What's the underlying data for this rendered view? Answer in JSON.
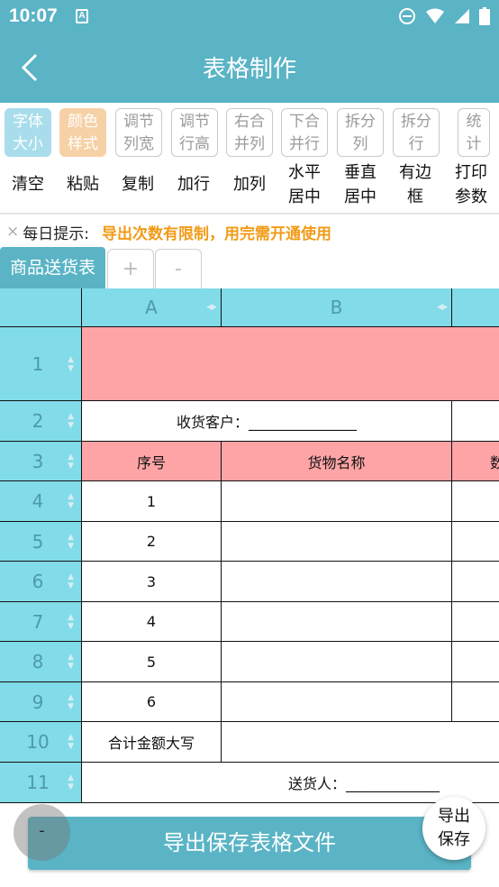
{
  "status": {
    "time": "10:07",
    "app_badge": "A"
  },
  "app": {
    "title": "表格制作"
  },
  "toolbar_row1": [
    {
      "line1": "字体",
      "line2": "大小",
      "style": "blue"
    },
    {
      "line1": "颜色",
      "line2": "样式",
      "style": "orange"
    },
    {
      "line1": "调节",
      "line2": "列宽",
      "style": "plain"
    },
    {
      "line1": "调节",
      "line2": "行高",
      "style": "plain"
    },
    {
      "line1": "右合",
      "line2": "并列",
      "style": "plain"
    },
    {
      "line1": "下合",
      "line2": "并行",
      "style": "plain"
    },
    {
      "line1": "拆分",
      "line2": "列",
      "style": "plain"
    },
    {
      "line1": "拆分",
      "line2": "行",
      "style": "plain"
    },
    {
      "line1": "统",
      "line2": "计",
      "style": "plain"
    }
  ],
  "toolbar_row2": [
    {
      "line1": "清空",
      "line2": ""
    },
    {
      "line1": "粘贴",
      "line2": ""
    },
    {
      "line1": "复制",
      "line2": ""
    },
    {
      "line1": "加行",
      "line2": ""
    },
    {
      "line1": "加列",
      "line2": ""
    },
    {
      "line1": "水平",
      "line2": "居中"
    },
    {
      "line1": "垂直",
      "line2": "居中"
    },
    {
      "line1": "有边",
      "line2": "框"
    },
    {
      "line1": "打印",
      "line2": "参数"
    }
  ],
  "tip": {
    "close": "×",
    "label": "每日提示:",
    "text": "导出次数有限制，用完需开通使用"
  },
  "tabs": {
    "active": "商品送货表",
    "add": "+",
    "remove": "-"
  },
  "sheet": {
    "columns": [
      "A",
      "B"
    ],
    "rows": [
      "1",
      "2",
      "3",
      "4",
      "5",
      "6",
      "7",
      "8",
      "9",
      "10",
      "11"
    ],
    "customer": "收货客户：_______________",
    "header_no": "序号",
    "header_name": "货物名称",
    "header_qty": "数",
    "numbers": [
      "1",
      "2",
      "3",
      "4",
      "5",
      "6"
    ],
    "total_label": "合计金额大写",
    "deliverer": "送货人：_____________"
  },
  "buttons": {
    "export": "导出保存表格文件",
    "minimize": "-",
    "save_line1": "导出",
    "save_line2": "保存"
  },
  "colors": {
    "primary": "#5ab4c5",
    "header_bg": "#82dbe9",
    "pink": "#ffa4a6",
    "tip": "#f29b17"
  }
}
